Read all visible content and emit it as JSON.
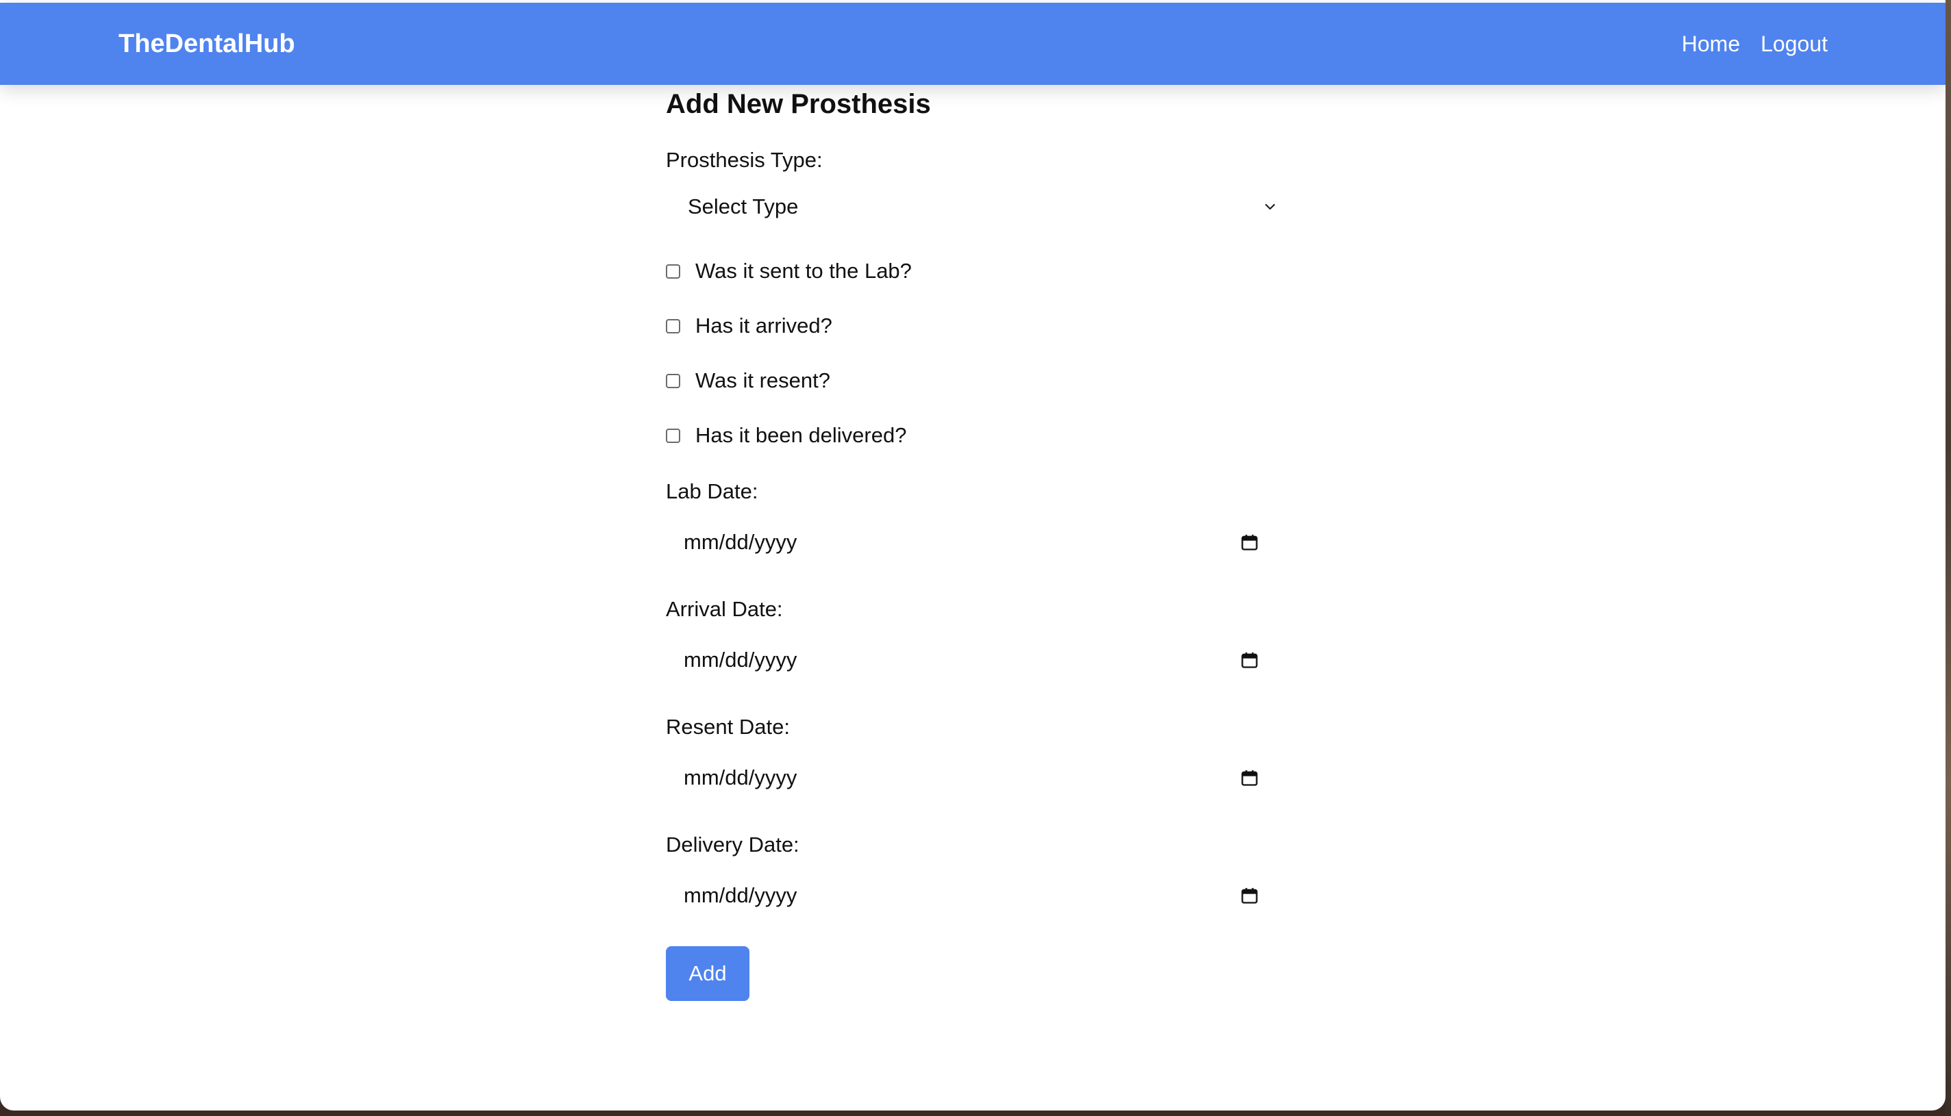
{
  "navbar": {
    "brand": "TheDentalHub",
    "links": [
      {
        "label": "Home"
      },
      {
        "label": "Logout"
      }
    ]
  },
  "form": {
    "title": "Add New Prosthesis",
    "prosthesis_type": {
      "label": "Prosthesis Type:",
      "selected": "Select Type"
    },
    "checkboxes": [
      {
        "label": "Was it sent to the Lab?",
        "checked": false
      },
      {
        "label": "Has it arrived?",
        "checked": false
      },
      {
        "label": "Was it resent?",
        "checked": false
      },
      {
        "label": "Has it been delivered?",
        "checked": false
      }
    ],
    "dates": [
      {
        "label": "Lab Date:",
        "placeholder": "mm/dd/yyyy"
      },
      {
        "label": "Arrival Date:",
        "placeholder": "mm/dd/yyyy"
      },
      {
        "label": "Resent Date:",
        "placeholder": "mm/dd/yyyy"
      },
      {
        "label": "Delivery Date:",
        "placeholder": "mm/dd/yyyy"
      }
    ],
    "submit_label": "Add"
  },
  "colors": {
    "accent": "#4f83ee",
    "background": "#ffffff",
    "text": "#111111"
  },
  "icons": {
    "select_indicator": "chevron-down-icon",
    "date_picker": "calendar-icon"
  }
}
